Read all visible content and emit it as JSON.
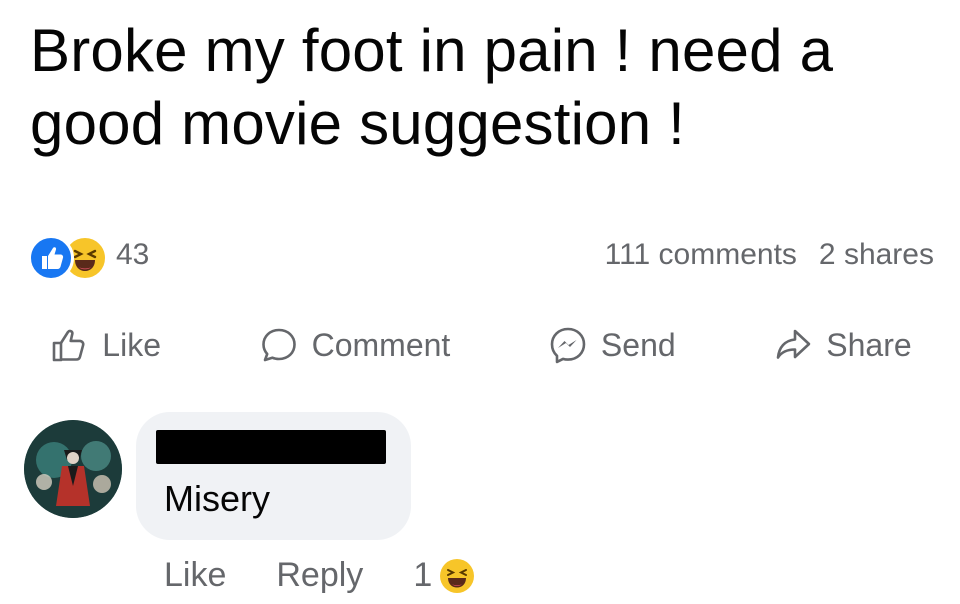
{
  "post": {
    "text": "Broke my foot in pain ! need a good movie suggestion !"
  },
  "stats": {
    "reaction_count": "43",
    "comments": "111 comments",
    "shares": "2 shares",
    "reaction_icons": [
      "like-icon",
      "haha-icon"
    ]
  },
  "actions": {
    "like": "Like",
    "comment": "Comment",
    "send": "Send",
    "share": "Share"
  },
  "comment": {
    "text": "Misery",
    "like": "Like",
    "reply": "Reply",
    "reaction_count": "1",
    "reaction_icon": "haha-icon"
  },
  "colors": {
    "like_blue": "#1877f2",
    "haha_yellow": "#f7c529",
    "muted_text": "#65676b",
    "bubble_bg": "#f0f2f5"
  }
}
